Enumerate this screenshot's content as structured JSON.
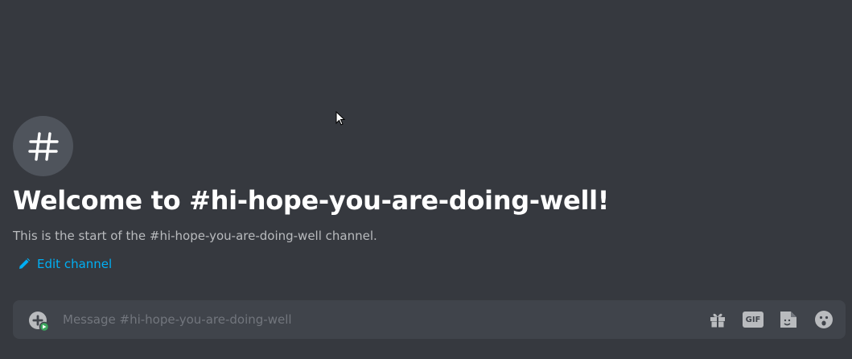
{
  "welcome": {
    "title": "Welcome to #hi-hope-you-are-doing-well!",
    "subtitle": "This is the start of the #hi-hope-you-are-doing-well channel.",
    "edit_label": "Edit channel"
  },
  "composer": {
    "placeholder": "Message #hi-hope-you-are-doing-well",
    "gif_label": "GIF"
  },
  "icons": {
    "channel": "hashtag-icon",
    "edit": "pencil-icon",
    "attach": "add-attachment-icon",
    "gift": "gift-icon",
    "gif": "gif-icon",
    "sticker": "sticker-icon",
    "emoji": "emoji-icon"
  },
  "colors": {
    "background": "#36393f",
    "composer": "#40444b",
    "accent_link": "#00aff4",
    "channel_icon_bg": "#4f545c"
  }
}
